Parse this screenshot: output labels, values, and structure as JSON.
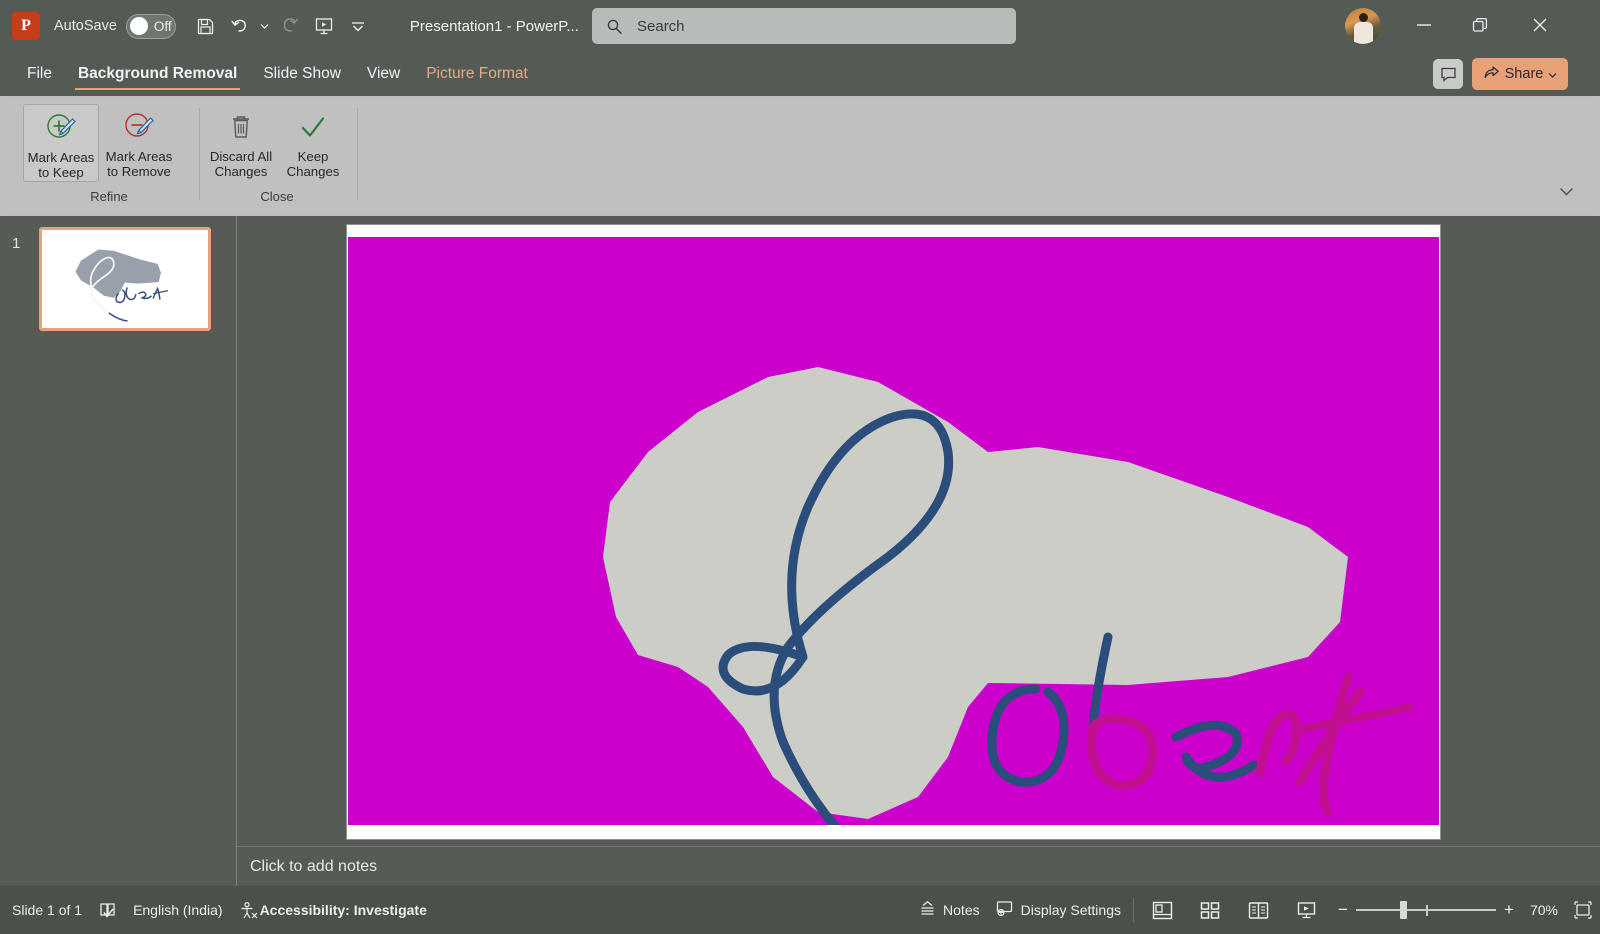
{
  "titlebar": {
    "app_logo": "powerpoint-logo",
    "logo_letter": "P",
    "autosave_label": "AutoSave",
    "autosave_state": "Off",
    "document_title": "Presentation1  -  PowerP...",
    "quick_access": [
      {
        "name": "save-icon",
        "label": "Save",
        "enabled": true
      },
      {
        "name": "undo-icon",
        "label": "Undo",
        "enabled": true
      },
      {
        "name": "undo-dropdown-icon",
        "label": "Undo options",
        "enabled": true
      },
      {
        "name": "redo-icon",
        "label": "Redo",
        "enabled": false
      },
      {
        "name": "start-presentation-icon",
        "label": "Start From Beginning",
        "enabled": true
      },
      {
        "name": "customize-quick-access-icon",
        "label": "Customize Quick Access Toolbar",
        "enabled": true
      }
    ],
    "window_controls": [
      {
        "name": "minimize-button",
        "label": "Minimize"
      },
      {
        "name": "restore-button",
        "label": "Restore Down"
      },
      {
        "name": "close-button",
        "label": "Close"
      }
    ]
  },
  "search": {
    "placeholder": "Search",
    "icon": "search-icon"
  },
  "account": {
    "avatar_name": "user-avatar"
  },
  "tabs": [
    {
      "label": "File",
      "active": false,
      "contextual": false
    },
    {
      "label": "Background Removal",
      "active": true,
      "contextual": false
    },
    {
      "label": "Slide Show",
      "active": false,
      "contextual": false
    },
    {
      "label": "View",
      "active": false,
      "contextual": false
    },
    {
      "label": "Picture Format",
      "active": false,
      "contextual": true
    }
  ],
  "tab_right": {
    "comments_label": "Comments",
    "share_label": "Share",
    "share_color": "#e9a178"
  },
  "ribbon": {
    "groups": [
      {
        "name": "refine",
        "label": "Refine",
        "buttons": [
          {
            "name": "mark-areas-to-keep-button",
            "line1": "Mark Areas",
            "line2": "to Keep",
            "icon": "plus-pen-icon",
            "selected": true
          },
          {
            "name": "mark-areas-to-remove-button",
            "line1": "Mark Areas",
            "line2": "to Remove",
            "icon": "minus-pen-icon",
            "selected": false
          }
        ]
      },
      {
        "name": "close",
        "label": "Close",
        "buttons": [
          {
            "name": "discard-all-changes-button",
            "line1": "Discard All",
            "line2": "Changes",
            "icon": "trash-icon",
            "selected": false
          },
          {
            "name": "keep-changes-button",
            "line1": "Keep",
            "line2": "Changes",
            "icon": "checkmark-icon",
            "selected": false
          }
        ]
      }
    ],
    "collapse_icon": "chevron-down-icon"
  },
  "slides_pane": {
    "slides": [
      {
        "number": "1",
        "selected": true,
        "name": "slide-thumbnail-1"
      }
    ]
  },
  "slide": {
    "removal_background_color": "#cc00cc",
    "kept_region_color": "#cdcdc7",
    "ink_color": "#2a4d7b",
    "ink_accent_color": "#c1108f",
    "signature_text": "Robert"
  },
  "notes": {
    "placeholder": "Click to add notes"
  },
  "statusbar": {
    "slide_count": "Slide 1 of 1",
    "spellcheck_icon": "spellcheck-icon",
    "language": "English (India)",
    "accessibility_icon": "accessibility-icon",
    "accessibility": "Accessibility: Investigate",
    "notes_label": "Notes",
    "notes_icon": "notes-icon",
    "display_settings_label": "Display Settings",
    "display_settings_icon": "display-settings-icon",
    "views": [
      {
        "name": "normal-view-button",
        "label": "Normal"
      },
      {
        "name": "slide-sorter-view-button",
        "label": "Slide Sorter"
      },
      {
        "name": "reading-view-button",
        "label": "Reading View"
      },
      {
        "name": "slide-show-button",
        "label": "Slide Show"
      }
    ],
    "zoom_out_label": "−",
    "zoom_in_label": "+",
    "zoom_level": "70%",
    "fit_icon": "fit-slide-to-window-icon"
  }
}
